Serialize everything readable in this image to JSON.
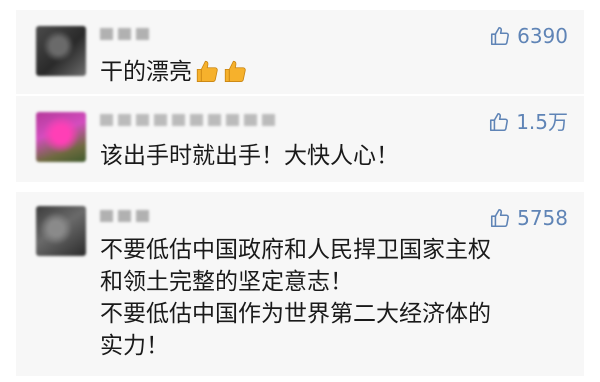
{
  "comments": [
    {
      "likes": "6390",
      "text": "干的漂亮"
    },
    {
      "likes": "1.5万",
      "text": "该出手时就出手！大快人心！"
    },
    {
      "likes": "5758",
      "text": "不要低估中国政府和人民捍卫国家主权\n和领土完整的坚定意志！\n不要低估中国作为世界第二大经济体的\n实力！"
    }
  ],
  "icons": {
    "like": "thumbs-up-outline-icon",
    "emoji": "thumbs-up-emoji-icon"
  },
  "colors": {
    "like_text": "#5f84b6",
    "comment_bg": "#f7f7f7",
    "emoji_fill": "#f6b12c"
  }
}
